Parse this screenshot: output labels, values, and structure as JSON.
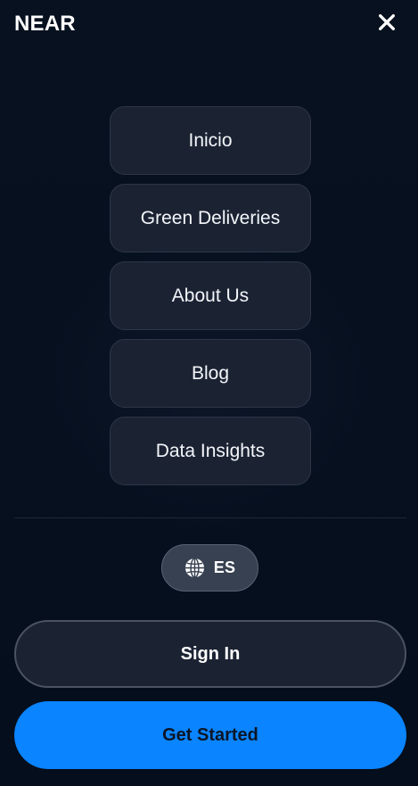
{
  "header": {
    "brand": "NEAR",
    "close_icon": "close-icon"
  },
  "nav": {
    "items": [
      {
        "label": "Inicio"
      },
      {
        "label": "Green Deliveries"
      },
      {
        "label": "About Us"
      },
      {
        "label": "Blog"
      },
      {
        "label": "Data Insights"
      }
    ]
  },
  "language": {
    "icon": "globe-icon",
    "label": "ES"
  },
  "actions": {
    "sign_in_label": "Sign In",
    "get_started_label": "Get Started"
  },
  "colors": {
    "background": "#06101f",
    "nav_item_bg": "#1b2333",
    "accent": "#0a84ff",
    "language_button_bg": "#374151"
  }
}
